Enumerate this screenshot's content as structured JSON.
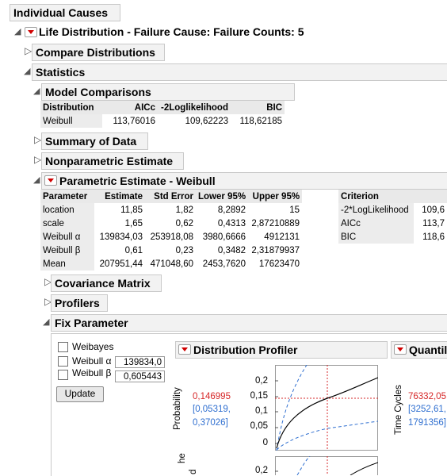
{
  "sections": {
    "individual_causes": "Individual Causes",
    "life_distribution": "Life Distribution - Failure Cause:  Failure Counts: 5",
    "compare_distributions": "Compare Distributions",
    "statistics": "Statistics",
    "model_comparisons": "Model Comparisons",
    "summary_of_data": "Summary of Data",
    "nonparametric_estimate": "Nonparametric Estimate",
    "parametric_estimate": "Parametric Estimate - Weibull",
    "covariance_matrix": "Covariance Matrix",
    "profilers": "Profilers",
    "fix_parameter": "Fix Parameter"
  },
  "model_comparisons": {
    "headers": [
      "Distribution",
      "AICc",
      "-2Loglikelihood",
      "BIC"
    ],
    "rows": [
      [
        "Weibull",
        "113,76016",
        "109,62223",
        "118,62185"
      ]
    ]
  },
  "parametric": {
    "headers": [
      "Parameter",
      "Estimate",
      "Std Error",
      "Lower 95%",
      "Upper 95%"
    ],
    "rows": [
      [
        "location",
        "11,85",
        "1,82",
        "8,2892",
        "15"
      ],
      [
        "scale",
        "1,65",
        "0,62",
        "0,4313",
        "2,87210889"
      ],
      [
        "Weibull α",
        "139834,03",
        "253918,08",
        "3980,6666",
        "4912131"
      ],
      [
        "Weibull β",
        "0,61",
        "0,23",
        "0,3482",
        "2,31879937"
      ],
      [
        "Mean",
        "207951,44",
        "471048,60",
        "2453,7620",
        "17623470"
      ]
    ],
    "criterion_header": "Criterion",
    "criterion_rows": [
      [
        "-2*LogLikelihood",
        "109,6"
      ],
      [
        "AICc",
        "113,7"
      ],
      [
        "BIC",
        "118,6"
      ]
    ]
  },
  "fix_param": {
    "weibayes": "Weibayes",
    "alpha_label": "Weibull α",
    "alpha_value": "139834,0",
    "beta_label": "Weibull β",
    "beta_value": "0,605443",
    "update": "Update"
  },
  "profiler": {
    "title": "Distribution Profiler",
    "ylabel": "Probability",
    "value": "0,146995",
    "ci_low": "[0,05319,",
    "ci_high": "0,37026]",
    "ticks": [
      "0,2",
      "0,15",
      "0,1",
      "0,05",
      "0"
    ],
    "bottom_tick": "0,2",
    "bottom_label_fragment": "he",
    "bottom_label_fragment2": "d"
  },
  "quantile": {
    "title": "Quantil",
    "ylabel": "Time Cycles",
    "value": "76332,05",
    "ci_low": "[3252,61,",
    "ci_high": "1791356]"
  },
  "colors": {
    "red": "#d62728",
    "blue": "#2f6fd0",
    "header_bg": "#e9e9e9"
  }
}
